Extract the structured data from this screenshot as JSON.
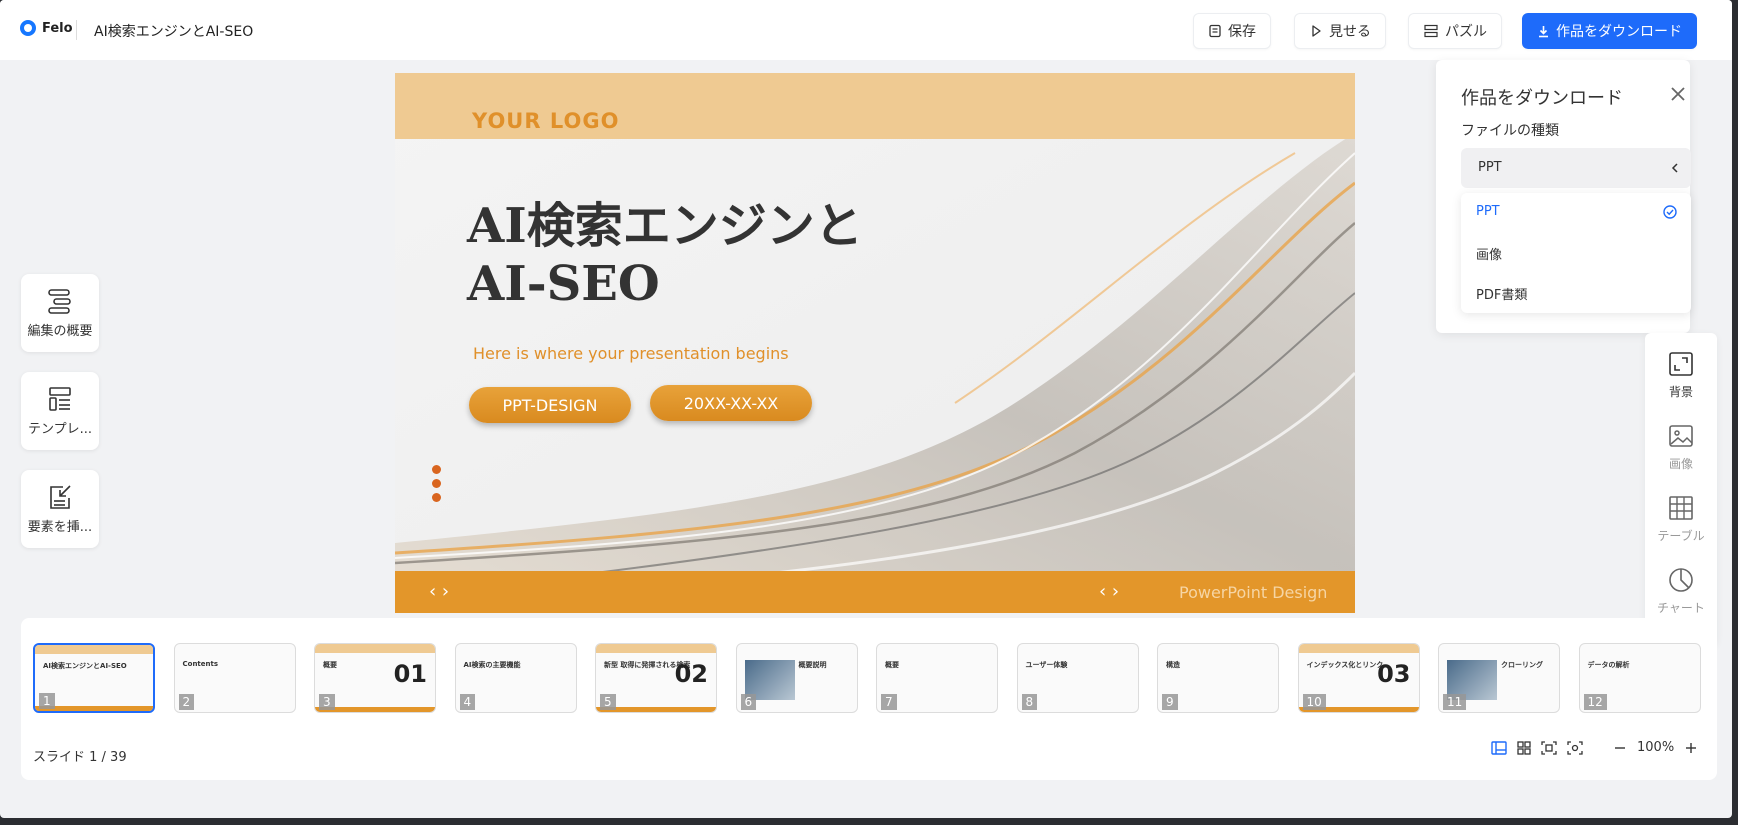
{
  "header": {
    "brand": "Felo",
    "doc_title": "AI検索エンジンとAI-SEO",
    "save_label": "保存",
    "present_label": "見せる",
    "puzzle_label": "パズル",
    "download_label": "作品をダウンロード"
  },
  "left_tools": [
    {
      "label": "編集の概要",
      "icon": "outline-icon"
    },
    {
      "label": "テンプレ...",
      "icon": "template-icon"
    },
    {
      "label": "要素を挿...",
      "icon": "insert-element-icon"
    }
  ],
  "slide": {
    "logo": "YOUR LOGO",
    "title": "AI検索エンジンとAI-SEO",
    "subtitle": "Here is where your presentation begins",
    "pill1": "PPT-DESIGN",
    "pill2": "20XX-XX-XX",
    "footer_text": "PowerPoint Design",
    "colors": {
      "orange": "#e3962a",
      "light_orange": "#efca92",
      "dots": "#d9651f"
    }
  },
  "download_panel": {
    "title": "作品をダウンロード",
    "file_type_label": "ファイルの種類",
    "selected": "PPT",
    "options": [
      "PPT",
      "画像",
      "PDF書類"
    ]
  },
  "right_tools": [
    {
      "label": "背景",
      "icon": "background-icon"
    },
    {
      "label": "画像",
      "icon": "image-icon"
    },
    {
      "label": "テーブル",
      "icon": "table-icon"
    },
    {
      "label": "チャート",
      "icon": "chart-icon"
    }
  ],
  "filmstrip": {
    "thumbs": [
      {
        "num": "1",
        "kind": "title",
        "text": "AI検索エンジンとAI-SEO"
      },
      {
        "num": "2",
        "kind": "contents",
        "text": "Contents"
      },
      {
        "num": "3",
        "kind": "section",
        "text": "概要",
        "big": "01"
      },
      {
        "num": "4",
        "kind": "content",
        "text": "AI検索の主要機能"
      },
      {
        "num": "5",
        "kind": "section",
        "text": "新型 取得に発揮される検索",
        "big": "02"
      },
      {
        "num": "6",
        "kind": "photo",
        "text": "概要説明"
      },
      {
        "num": "7",
        "kind": "content",
        "text": "概要"
      },
      {
        "num": "8",
        "kind": "content",
        "text": "ユーザー体験"
      },
      {
        "num": "9",
        "kind": "content",
        "text": "構造"
      },
      {
        "num": "10",
        "kind": "section",
        "text": "インデックス化とリンク",
        "big": "03"
      },
      {
        "num": "11",
        "kind": "photo",
        "text": "クローリング"
      },
      {
        "num": "12",
        "kind": "content",
        "text": "データの解析"
      }
    ],
    "slide_count": "スライド 1 / 39",
    "zoom": "100%"
  }
}
